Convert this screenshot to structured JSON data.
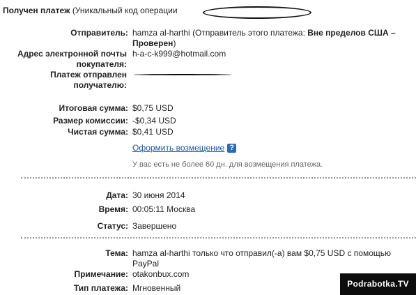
{
  "header": {
    "title": "Получен платеж",
    "subtitle": "(Уникальный код операции"
  },
  "sender": {
    "label": "Отправитель:",
    "name": "hamza al-harthi",
    "note_prefix": "(Отправитель этого платежа:",
    "note_bold": "Вне пределов США – Проверен",
    "note_suffix": ")"
  },
  "buyer_email": {
    "label": "Адрес электронной почты покупателя:",
    "value": "h-a-c-k999@hotmail.com"
  },
  "sent_to": {
    "label": "Платеж отправлен получателю:"
  },
  "amounts": {
    "total_label": "Итоговая сумма:",
    "total_value": "$0,75 USD",
    "fee_label": "Размер комиссии:",
    "fee_value": "-$0,34 USD",
    "net_label": "Чистая сумма:",
    "net_value": "$0,41 USD"
  },
  "refund": {
    "link_label": "Оформить возмещение",
    "help_icon": "?",
    "note": "У вас есть не более 60 дн. для возмещения платежа."
  },
  "details": {
    "date_label": "Дата:",
    "date_value": "30 июня 2014",
    "time_label": "Время:",
    "time_value": "00:05:11 Москва",
    "status_label": "Статус:",
    "status_value": "Завершено"
  },
  "message": {
    "subject_label": "Тема:",
    "subject_value": "hamza al-harthi только что отправил(-а) вам $0,75 USD с помощью PayPal",
    "note_label": "Примечание:",
    "note_value": "otakonbux.com",
    "type_label": "Тип платежа:",
    "type_value": "Мгновенный"
  },
  "watermark": "Podrabotka.TV"
}
